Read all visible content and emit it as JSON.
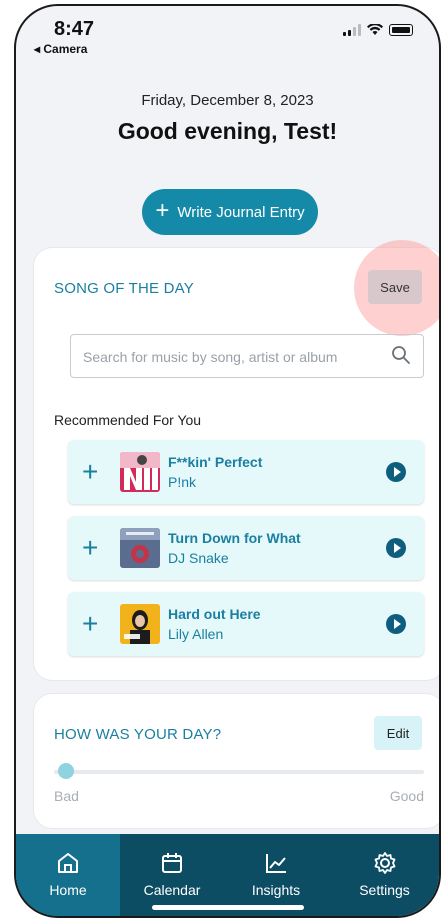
{
  "status": {
    "time": "8:47",
    "back_label": "◂ Camera"
  },
  "header": {
    "date": "Friday, December 8, 2023",
    "greeting": "Good evening, Test!"
  },
  "write_button": {
    "label": "Write Journal Entry",
    "icon": "plus-icon"
  },
  "song_card": {
    "title": "SONG OF THE DAY",
    "save_label": "Save",
    "search": {
      "placeholder": "Search for music by song, artist or album",
      "value": ""
    },
    "recommended_title": "Recommended For You",
    "tracks": [
      {
        "title": "F**kin' Perfect",
        "artist": "P!nk"
      },
      {
        "title": "Turn Down for What",
        "artist": "DJ Snake"
      },
      {
        "title": "Hard out Here",
        "artist": "Lily Allen"
      }
    ]
  },
  "day_card": {
    "title": "HOW WAS YOUR DAY?",
    "edit_label": "Edit",
    "slider_value": 0,
    "low_label": "Bad",
    "high_label": "Good"
  },
  "tabs": [
    {
      "label": "Home",
      "icon": "home-icon",
      "active": true
    },
    {
      "label": "Calendar",
      "icon": "calendar-icon",
      "active": false
    },
    {
      "label": "Insights",
      "icon": "chart-icon",
      "active": false
    },
    {
      "label": "Settings",
      "icon": "gear-icon",
      "active": false
    }
  ],
  "colors": {
    "accent": "#148aa8",
    "tabbar": "#0d4d64",
    "tab_active": "#14708d",
    "track_bg": "#e5f9fb"
  }
}
